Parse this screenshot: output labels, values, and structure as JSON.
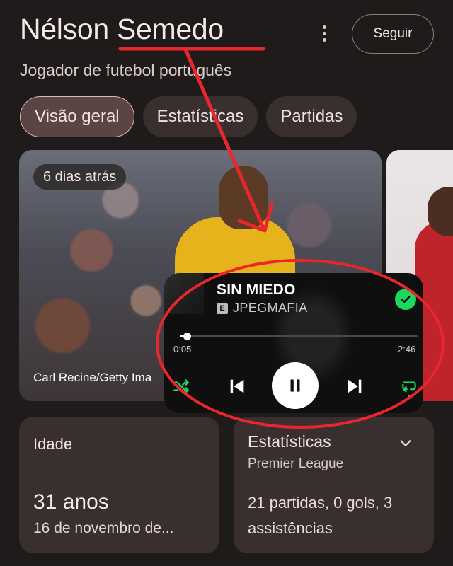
{
  "header": {
    "title": "Nélson Semedo",
    "subtitle": "Jogador de futebol português",
    "follow_label": "Seguir"
  },
  "tabs": [
    {
      "label": "Visão geral",
      "active": true
    },
    {
      "label": "Estatísticas",
      "active": false
    },
    {
      "label": "Partidas",
      "active": false
    }
  ],
  "media_card": {
    "time_badge": "6 dias atrás",
    "credit": "Carl Recine/Getty Ima"
  },
  "music_player": {
    "song_title": "SIN MIEDO",
    "explicit_badge": "E",
    "artist": "JPEGMAFIA",
    "elapsed": "0:05",
    "duration": "2:46",
    "progress": 0.03,
    "liked": true,
    "accent_color": "#1ed760"
  },
  "info_cards": {
    "age": {
      "label": "Idade",
      "value": "31 anos",
      "sub": "16 de novembro de..."
    },
    "stats": {
      "title": "Estatísticas",
      "league": "Premier League",
      "summary": "21 partidas, 0 gols, 3 assistências"
    }
  },
  "icons": {
    "more": "more-vert-icon",
    "shuffle": "shuffle-icon",
    "previous": "skip-previous-icon",
    "pause": "pause-icon",
    "next": "skip-next-icon",
    "repeat": "repeat-icon",
    "check": "check-icon",
    "chevron": "chevron-down-icon"
  },
  "annotation_color": "#e8262b"
}
